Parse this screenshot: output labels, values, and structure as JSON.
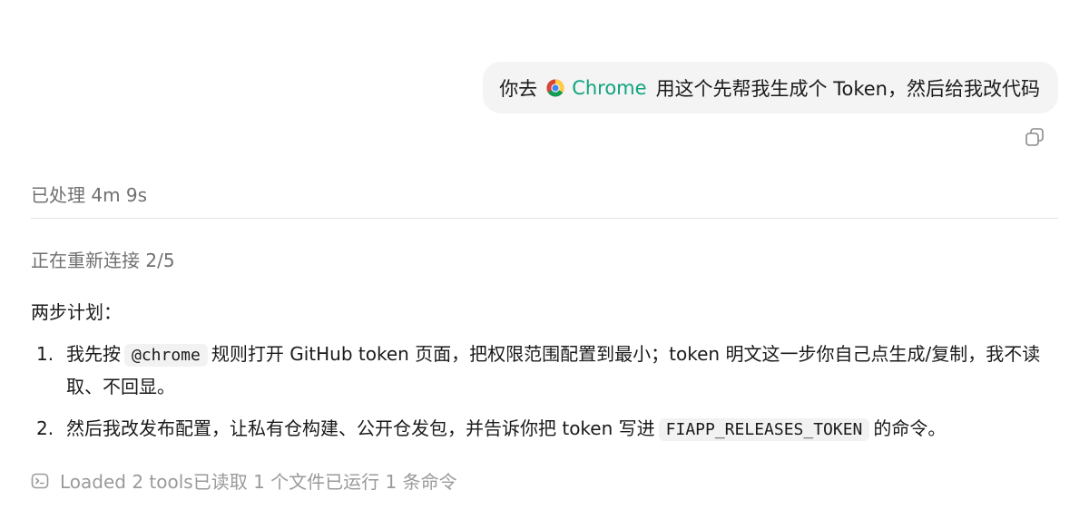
{
  "user_message": {
    "prefix": "你去",
    "mention": "Chrome",
    "suffix": "用这个先帮我生成个 Token，然后给我改代码"
  },
  "processed_status": "已处理 4m 9s",
  "reconnect_status": "正在重新连接 2/5",
  "plan": {
    "title": "两步计划：",
    "items": [
      {
        "number": "1.",
        "before_code": "我先按",
        "code": "@chrome",
        "after_code": "规则打开 GitHub token 页面，把权限范围配置到最小；token 明文这一步你自己点生成/复制，我不读取、不回显。"
      },
      {
        "number": "2.",
        "before_code": "然后我改发布配置，让私有仓构建、公开仓发包，并告诉你把 token 写进",
        "code": "FIAPP_RELEASES_TOKEN",
        "after_code": "的命令。"
      }
    ]
  },
  "tools_summary": "Loaded 2 tools已读取 1 个文件已运行 1 条命令",
  "icons": {
    "mention_icon": "chrome-icon",
    "copy_icon": "copy-icon",
    "tools_icon": "terminal-icon"
  },
  "colors": {
    "mention_text": "#10a37f",
    "bubble_bg": "#f4f4f4",
    "muted_text": "#707070"
  }
}
